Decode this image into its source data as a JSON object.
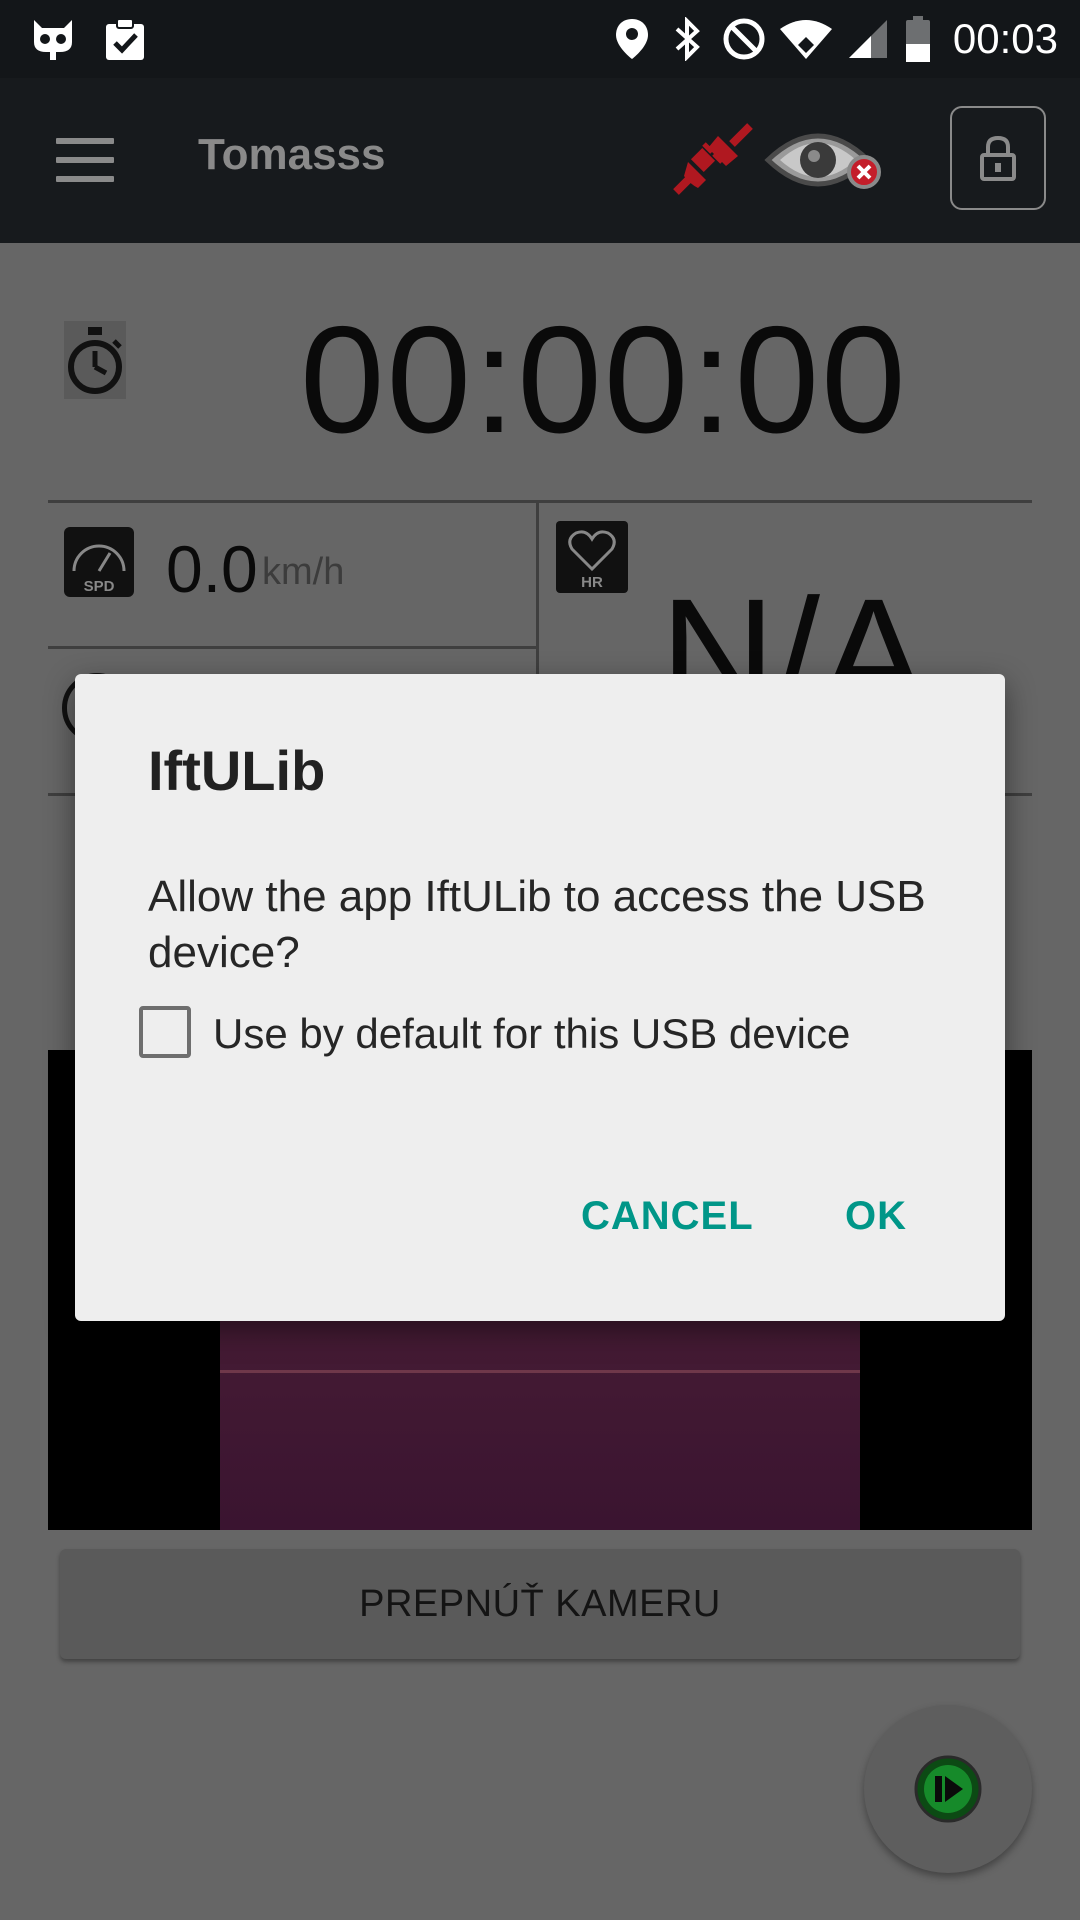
{
  "status_bar": {
    "time": "00:03",
    "left_icons": [
      "cyanogen-icon",
      "clipboard-check-icon"
    ],
    "right_icons": [
      "location-icon",
      "bluetooth-icon",
      "do-not-disturb-icon",
      "wifi-icon",
      "signal-icon",
      "battery-icon"
    ]
  },
  "toolbar": {
    "title": "Tomasss",
    "icons": [
      "menu-icon",
      "plug-disconnected-icon",
      "eye-closed-icon",
      "lock-icon"
    ]
  },
  "stats": {
    "timer": "00:00:00",
    "speed_value": "0.0",
    "speed_unit": "km/h",
    "speed_icon_label": "SPD",
    "hr_value": "N/A",
    "hr_icon_label": "HR"
  },
  "camera": {
    "switch_label": "PREPNÚŤ KAMERU"
  },
  "dialog": {
    "title": "IftULib",
    "message": "Allow the app IftULib to access the USB device?",
    "checkbox_label": "Use by default for this USB device",
    "checkbox_checked": false,
    "cancel_label": "CANCEL",
    "ok_label": "OK",
    "accent_color": "#009688"
  }
}
